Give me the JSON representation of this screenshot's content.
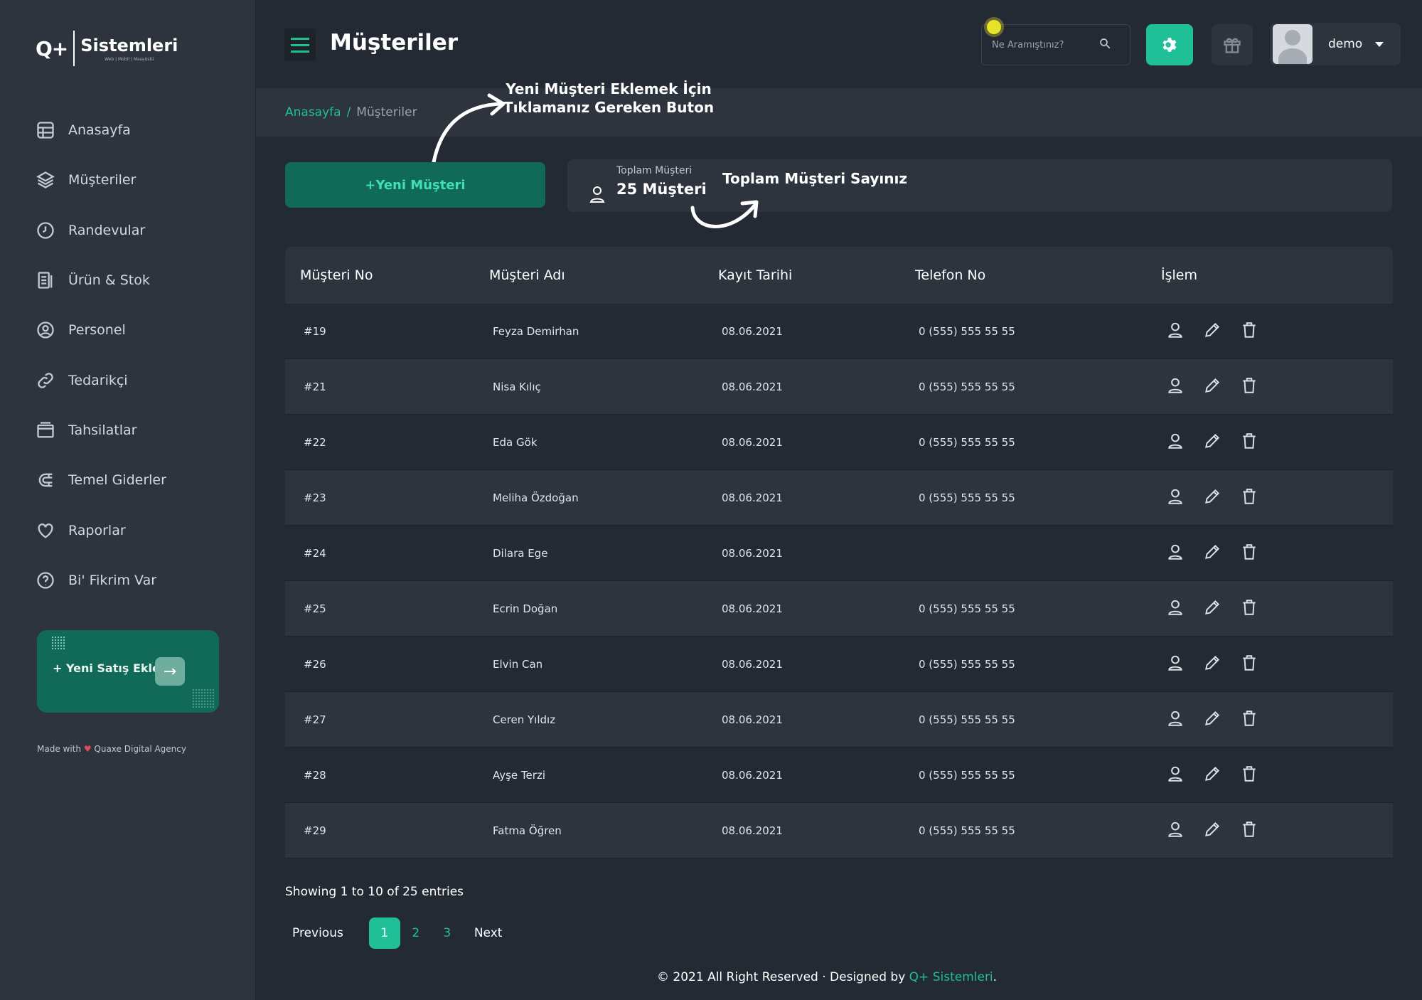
{
  "brand": {
    "mark": "Q+",
    "name": "Sistemleri",
    "tagline": "Web | Mobil | Masaüstü"
  },
  "sidebar": {
    "items": [
      {
        "label": "Anasayfa",
        "icon": "dashboard-icon"
      },
      {
        "label": "Müşteriler",
        "icon": "layers-icon"
      },
      {
        "label": "Randevular",
        "icon": "clock-icon"
      },
      {
        "label": "Ürün & Stok",
        "icon": "clipboard-icon"
      },
      {
        "label": "Personel",
        "icon": "user-circle-icon"
      },
      {
        "label": "Tedarikçi",
        "icon": "link-icon"
      },
      {
        "label": "Tahsilatlar",
        "icon": "folder-icon"
      },
      {
        "label": "Temel Giderler",
        "icon": "magnet-icon"
      },
      {
        "label": "Raporlar",
        "icon": "heart-icon"
      },
      {
        "label": "Bi' Fikrim Var",
        "icon": "help-icon"
      }
    ],
    "sale_button": "+ Yeni Satış Ekle",
    "made_with_prefix": "Made with",
    "made_with_suffix": "Quaxe Digital Agency"
  },
  "header": {
    "title": "Müşteriler",
    "search_placeholder": "Ne Aramıştınız?",
    "user_name": "demo"
  },
  "breadcrumb": {
    "home": "Anasayfa",
    "separator": "/",
    "current": "Müşteriler"
  },
  "annotations": {
    "new_button_hint_line1": "Yeni Müşteri Eklemek İçin",
    "new_button_hint_line2": "Tıklamanız Gereken Buton",
    "total_hint": "Toplam Müşteri Sayınız"
  },
  "new_customer_button": "+Yeni Müşteri",
  "total": {
    "label": "Toplam Müşteri",
    "value": "25 Müşteri"
  },
  "table": {
    "headers": [
      "Müşteri No",
      "Müşteri Adı",
      "Kayıt Tarihi",
      "Telefon No",
      "İşlem"
    ],
    "rows": [
      {
        "no": "#19",
        "name": "Feyza Demirhan",
        "date": "08.06.2021",
        "phone": "0 (555) 555 55 55"
      },
      {
        "no": "#21",
        "name": "Nisa Kılıç",
        "date": "08.06.2021",
        "phone": "0 (555) 555 55 55"
      },
      {
        "no": "#22",
        "name": "Eda Gök",
        "date": "08.06.2021",
        "phone": "0 (555) 555 55 55"
      },
      {
        "no": "#23",
        "name": "Meliha Özdoğan",
        "date": "08.06.2021",
        "phone": "0 (555) 555 55 55"
      },
      {
        "no": "#24",
        "name": "Dilara Ege",
        "date": "08.06.2021",
        "phone": ""
      },
      {
        "no": "#25",
        "name": "Ecrin Doğan",
        "date": "08.06.2021",
        "phone": "0 (555) 555 55 55"
      },
      {
        "no": "#26",
        "name": "Elvin Can",
        "date": "08.06.2021",
        "phone": "0 (555) 555 55 55"
      },
      {
        "no": "#27",
        "name": "Ceren Yıldız",
        "date": "08.06.2021",
        "phone": "0 (555) 555 55 55"
      },
      {
        "no": "#28",
        "name": "Ayşe Terzi",
        "date": "08.06.2021",
        "phone": "0 (555) 555 55 55"
      },
      {
        "no": "#29",
        "name": "Fatma Öğren",
        "date": "08.06.2021",
        "phone": "0 (555) 555 55 55"
      }
    ]
  },
  "pagination": {
    "showing": "Showing 1 to 10 of 25 entries",
    "previous": "Previous",
    "pages": [
      "1",
      "2",
      "3"
    ],
    "active_page": "1",
    "next": "Next"
  },
  "footer": {
    "text": "© 2021 All Right Reserved · Designed by",
    "brand": "Q+ Sistemleri",
    "end": "."
  },
  "colors": {
    "accent": "#1fbf97",
    "accent_dark": "#116a58",
    "bg": "#242a33",
    "panel": "#2d343e",
    "notification": "#e6e32a"
  }
}
